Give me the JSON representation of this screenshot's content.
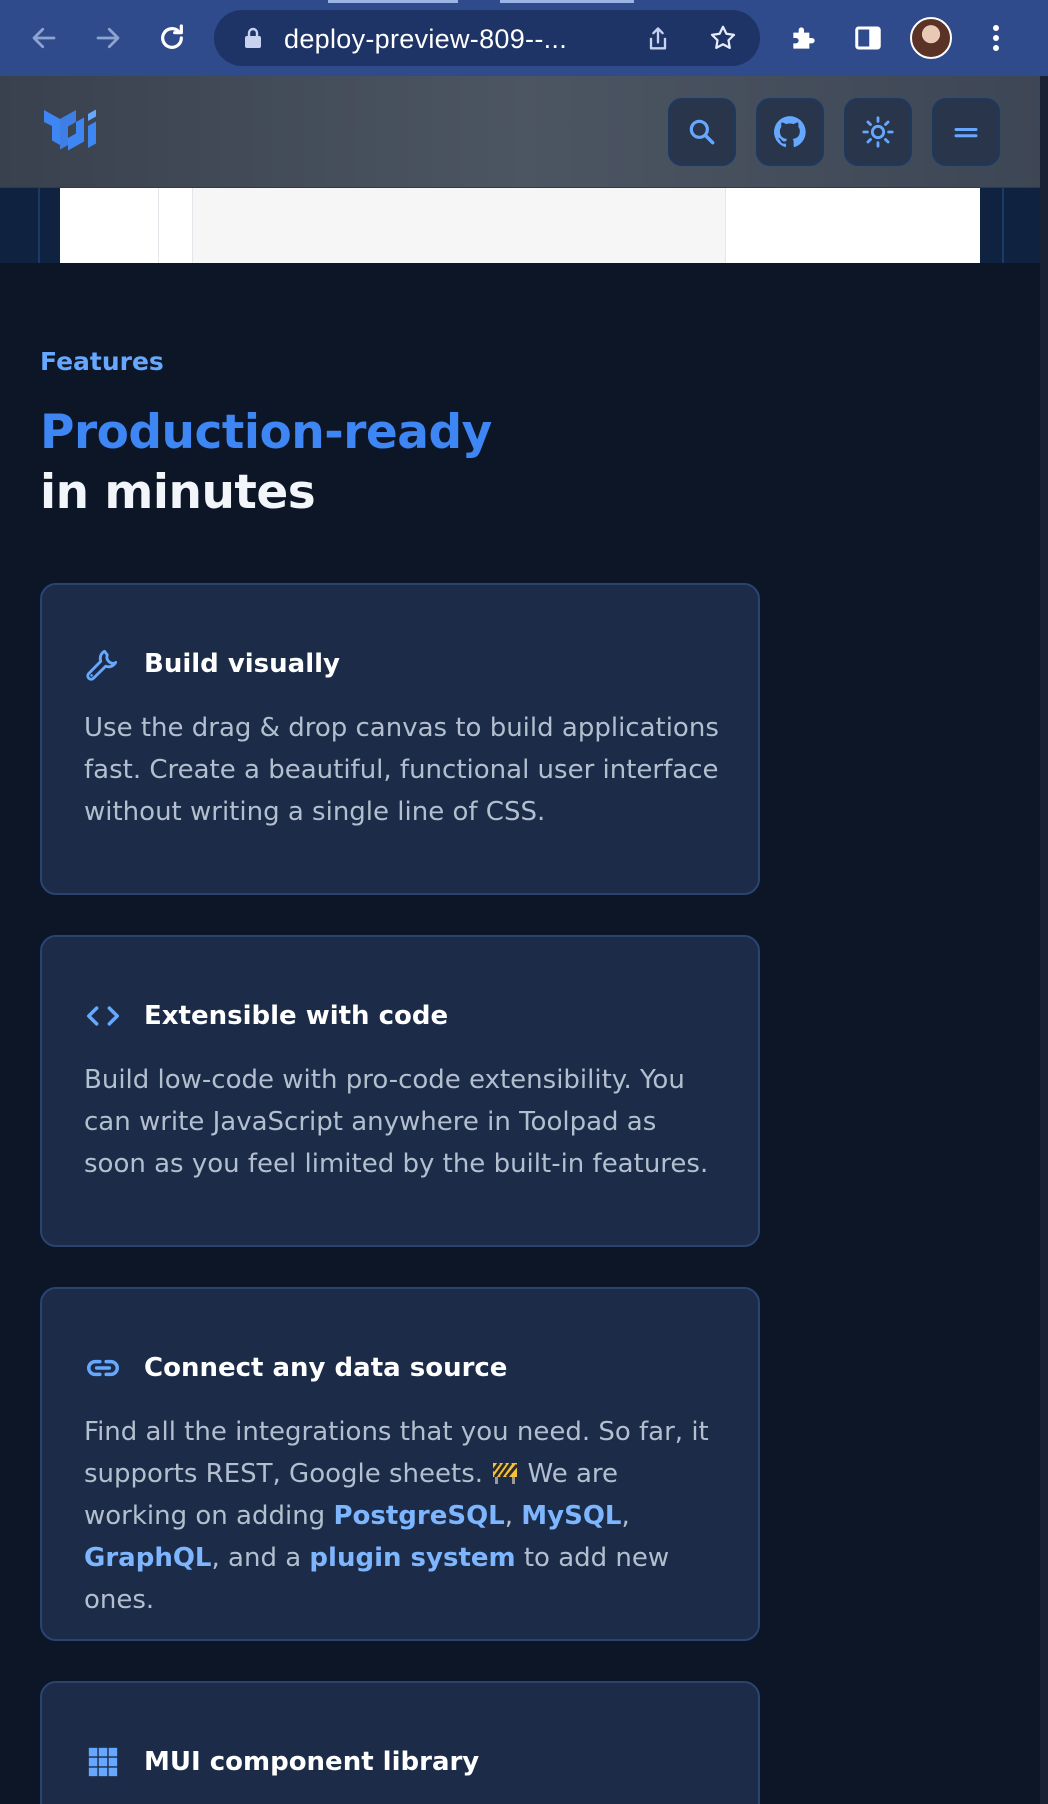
{
  "browser": {
    "url": "deploy-preview-809--...",
    "back_icon": "arrow-left-icon",
    "forward_icon": "arrow-right-icon",
    "reload_icon": "reload-icon",
    "colors": {
      "chrome_bg": "#2f4b8c",
      "omnibox_bg": "#1e3466"
    }
  },
  "header": {
    "logo": "mui-logo",
    "buttons": [
      "search-icon",
      "github-icon",
      "sun-icon",
      "menu-icon"
    ],
    "accent": "#3f86f5"
  },
  "features": {
    "overline": "Features",
    "headline_accent": "Production-ready",
    "headline_rest": "in minutes",
    "cards": [
      {
        "icon": "wrench-icon",
        "title": "Build visually",
        "description": "Use the drag & drop canvas to build applications fast. Create a beautiful, functional user interface without writing a single line of CSS."
      },
      {
        "icon": "code-icon",
        "title": "Extensible with code",
        "description": "Build low-code with pro-code extensibility. You can write JavaScript anywhere in Toolpad as soon as you feel limited by the built-in features."
      },
      {
        "icon": "link-icon",
        "title": "Connect any data source",
        "description_part1": "Find all the integrations that you need. So far, it supports REST, Google sheets.",
        "description_part2": "We are working on adding",
        "links": [
          "PostgreSQL",
          "MySQL",
          "GraphQL",
          "plugin system"
        ],
        "sep_comma": ",",
        "sep_and": ", and a",
        "description_end": "to add new ones."
      },
      {
        "icon": "grid-icon",
        "title": "MUI component library"
      }
    ]
  },
  "colors": {
    "page_bg": "#0c1627",
    "card_bg": "#1c2c48",
    "card_border": "#2a4470",
    "link": "#7db6ff",
    "overline": "#66a8ff"
  }
}
